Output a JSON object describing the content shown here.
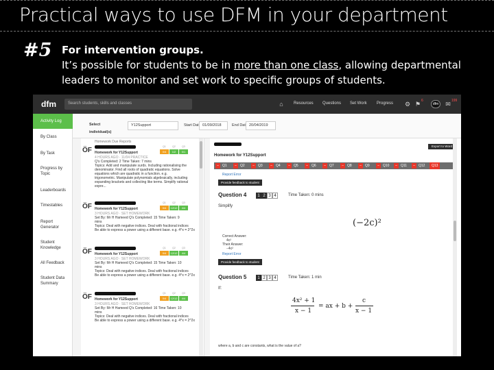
{
  "slide": {
    "title": "Practical ways to use DFM in your department",
    "number": "#5",
    "heading": "For intervention groups.",
    "body_pre": "It’s possible for students to be in ",
    "body_link": "more than one class",
    "body_post": ", allowing departmental leaders to monitor and set work to specific groups of students."
  },
  "app": {
    "logo": "dfm",
    "search_placeholder": "Search students, skills and classes",
    "nav": [
      "Resources",
      "Questions",
      "Set Work",
      "Progress"
    ],
    "badge_settings": "6",
    "user_badge": "dfm",
    "badge_notifications": "199",
    "icons": {
      "home": "home-icon",
      "settings": "gear-icon",
      "notifications": "bell-icon"
    }
  },
  "sidebar": {
    "items": [
      {
        "label": "Activity Log",
        "active": true
      },
      {
        "label": "By Class"
      },
      {
        "label": "By Task"
      },
      {
        "label": "Progress by Topic"
      },
      {
        "label": "Leaderboards"
      },
      {
        "label": "Timestables"
      },
      {
        "label": "Report Generator"
      },
      {
        "label": "Student Knowledge"
      },
      {
        "label": "All Feedback"
      },
      {
        "label": "Student Data Summary"
      }
    ]
  },
  "filters": {
    "select_individual": "Select individual(s)",
    "class_value": "Y12Support",
    "start_label": "Start Date",
    "start_value": "01/09/2018",
    "end_label": "End Date",
    "end_value": "20/04/2019"
  },
  "activity": {
    "section": "Homework Due Reports",
    "cards": [
      {
        "title": "Homework for Y12Support",
        "meta": "4 HOURS AGO · 11/04 PRACTICE",
        "set": "Q's Completed: 2   Time Taken: 7 mins",
        "topics": "Topics: Add and manipulate surds. Including rationalising the",
        "extra1": "denominator. Find all roots of quadratic equations. Solve",
        "extra2": "equations which are quadratic in a function. e.g.",
        "extra3": "trigonometric. Manipulate polynomials algebraically, including",
        "extra4": "expanding brackets and collecting like terms. Simplify rational",
        "extra5": "expre...",
        "scores": [
          "0/4",
          "1/2",
          "0/1"
        ]
      },
      {
        "title": "Homework for Y12Support",
        "meta": "3 HOURS AGO · SET HOMEWORK",
        "set": "Set By: Mr H Hameed   Q's Completed: 15   Time Taken: 9",
        "topics": "mins",
        "extra1": "Topics: Deal with negative indices. Deal with fractional indices",
        "extra2": "Be able to express a power using a different base. e.g. 4^x = 2^2x",
        "scores": [
          "0/4",
          "12/12",
          "4/4"
        ]
      },
      {
        "title": "Homework for Y12Support",
        "meta": "3 HOURS AGO · SET HOMEWORK",
        "set": "Set By: Mr H Hameed   Q's Completed: 15   Time Taken: 10",
        "topics": "mins",
        "extra1": "Topics: Deal with negative indices. Deal with fractional indices",
        "extra2": "Be able to express a power using a different base. e.g. 4^x = 2^2x",
        "scores": [
          "0/4",
          "12/12",
          "4/4"
        ]
      },
      {
        "title": "Homework for Y12Support",
        "meta": "3 HOURS AGO · SET HOMEWORK",
        "set": "Set By: Mr H Hameed   Q's Completed: 16   Time Taken: 10",
        "topics": "mins",
        "extra1": "Topics: Deal with negative indices. Deal with fractional indices",
        "extra2": "Be able to express a power using a different base. e.g. 4^x = 2^2x",
        "scores": [
          "0/4",
          "12/12",
          "4/4"
        ]
      }
    ],
    "score_labels": [
      "Q1",
      "Q2",
      "Q3"
    ],
    "score_colors": [
      "#f0a020",
      "#5cbf4a",
      "#5cbf4a"
    ]
  },
  "detail": {
    "export": "Export to Word",
    "heading": "Homework for Y12Support",
    "questions": [
      "Q1",
      "Q2",
      "Q3",
      "Q4",
      "Q5",
      "Q6",
      "Q7",
      "Q8",
      "Q9",
      "Q10",
      "Q11",
      "Q12"
    ],
    "last_question": "Q13",
    "report_error": "Report Error",
    "feedback": "Provide feedback to student",
    "q4": {
      "title": "Question 4",
      "tabs": [
        "1",
        "2",
        "3",
        "4"
      ],
      "time": "Time Taken: 0 mins",
      "prompt": "Simplify",
      "expr": "(−2c)²",
      "correct_label": "Correct Answer:",
      "correct_value": "4c²",
      "their_label": "Their Answer:",
      "their_value": "−4c²"
    },
    "q5": {
      "title": "Question 5",
      "tabs": [
        "1",
        "2",
        "3",
        "4"
      ],
      "time": "Time Taken: 1 min",
      "prompt": "If:",
      "expr_lhs_num": "4x² + 1",
      "expr_lhs_den": "x − 1",
      "expr_mid": "= ax + b +",
      "expr_rhs_num": "c",
      "expr_rhs_den": "x − 1",
      "footer": "where a, b and c are constants, what is the value of a?"
    }
  }
}
